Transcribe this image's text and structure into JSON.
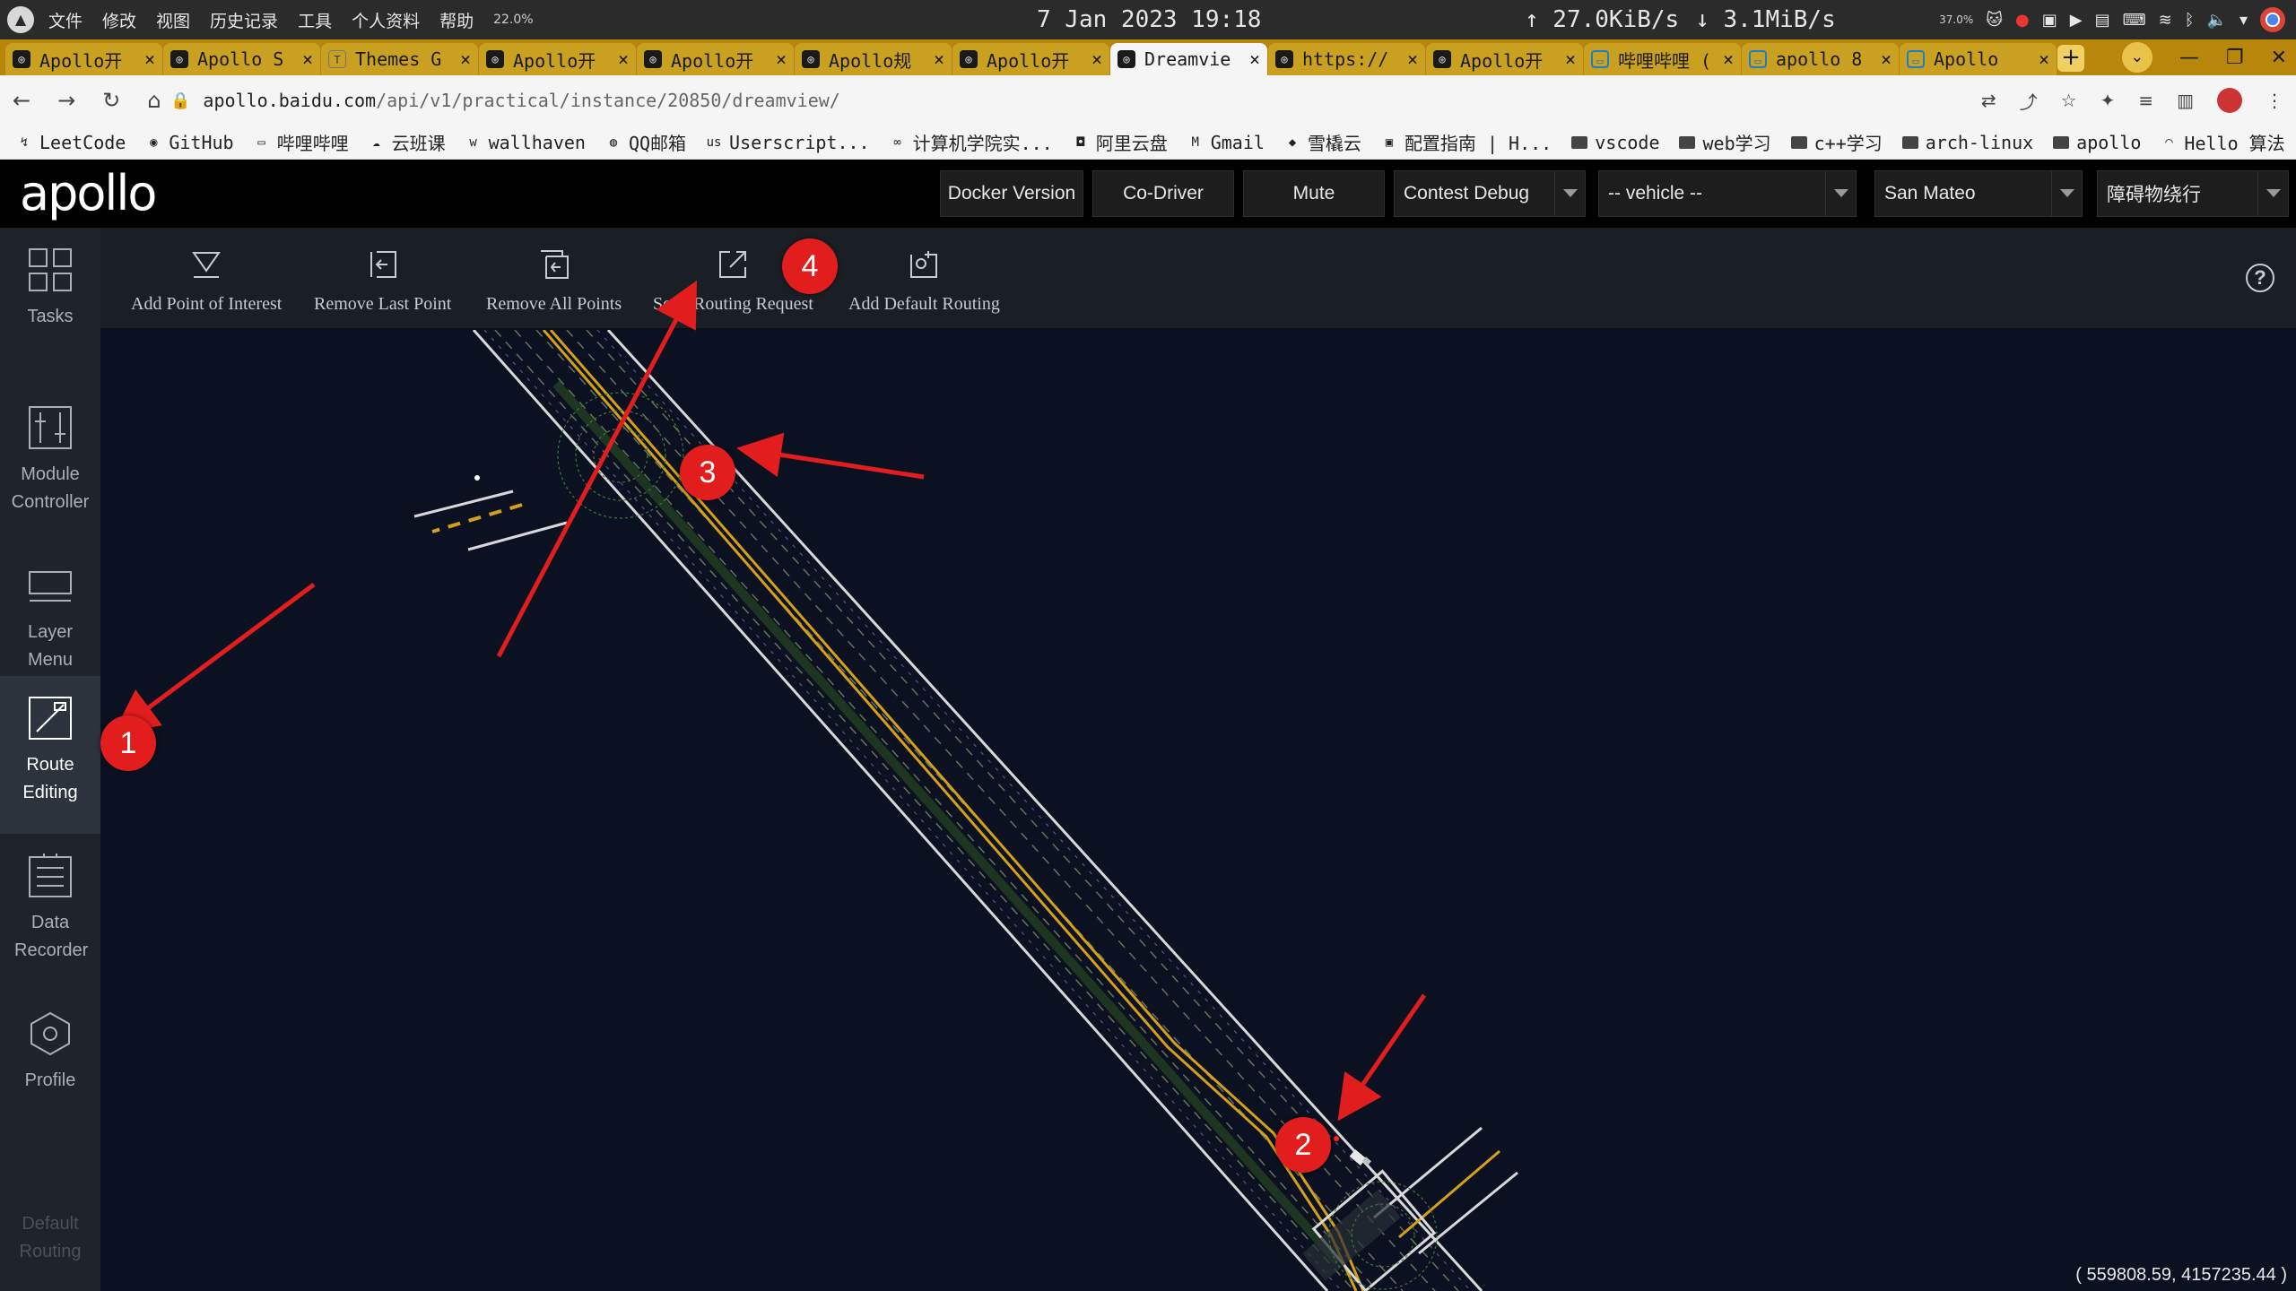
{
  "system_bar": {
    "menu": [
      "文件",
      "修改",
      "视图",
      "历史记录",
      "工具",
      "个人资料",
      "帮助"
    ],
    "cpu": "22.0%",
    "datetime": "7 Jan 2023 19:18",
    "net_up": "↑ 27.0KiB/s",
    "net_down": "↓ 3.1MiB/s",
    "tray_pct": "37.0%"
  },
  "tabs": [
    {
      "title": "Apollo开",
      "icon": "apollo"
    },
    {
      "title": "Apollo S",
      "icon": "apollo"
    },
    {
      "title": "Themes G",
      "icon": "themes"
    },
    {
      "title": "Apollo开",
      "icon": "apollo"
    },
    {
      "title": "Apollo开",
      "icon": "apollo"
    },
    {
      "title": "Apollo规",
      "icon": "apollo"
    },
    {
      "title": "Apollo开",
      "icon": "apollo"
    },
    {
      "title": "Dreamvie",
      "icon": "apollo",
      "active": true
    },
    {
      "title": "https://",
      "icon": "apollo"
    },
    {
      "title": "Apollo开",
      "icon": "apollo"
    },
    {
      "title": "哔哩哔哩 (",
      "icon": "bilibili"
    },
    {
      "title": "apollo 8",
      "icon": "bilibili"
    },
    {
      "title": "Apollo",
      "icon": "bilibili"
    }
  ],
  "url": {
    "host": "apollo.baidu.com",
    "path": "/api/v1/practical/instance/20850/dreamview/"
  },
  "bookmarks": [
    {
      "label": "LeetCode",
      "icon": "leetcode-icon"
    },
    {
      "label": "GitHub",
      "icon": "github-icon"
    },
    {
      "label": "哔哩哔哩",
      "icon": "bilibili-icon"
    },
    {
      "label": "云班课",
      "icon": "cloud-class-icon"
    },
    {
      "label": "wallhaven",
      "icon": "wallhaven-icon"
    },
    {
      "label": "QQ邮箱",
      "icon": "qqmail-icon"
    },
    {
      "label": "Userscript...",
      "icon": "userscript-icon"
    },
    {
      "label": "计算机学院实...",
      "icon": "college-icon"
    },
    {
      "label": "阿里云盘",
      "icon": "aliyun-icon"
    },
    {
      "label": "Gmail",
      "icon": "gmail-icon"
    },
    {
      "label": "雪橇云",
      "icon": "sled-icon"
    },
    {
      "label": "配置指南 | H...",
      "icon": "guide-icon"
    },
    {
      "label": "vscode",
      "icon": "folder-icon"
    },
    {
      "label": "web学习",
      "icon": "folder-icon"
    },
    {
      "label": "c++学习",
      "icon": "folder-icon"
    },
    {
      "label": "arch-linux",
      "icon": "folder-icon"
    },
    {
      "label": "apollo",
      "icon": "folder-icon"
    },
    {
      "label": "Hello 算法",
      "icon": "hello-icon"
    }
  ],
  "apollo": {
    "logo": "apollo",
    "buttons": {
      "docker": "Docker Version",
      "codriver": "Co-Driver",
      "mute": "Mute"
    },
    "selects": {
      "mode": "Contest Debug",
      "vehicle": "-- vehicle --",
      "map": "San Mateo",
      "scenario": "障碍物绕行"
    }
  },
  "sidebar": [
    {
      "label": "Tasks",
      "icon": "tasks-icon"
    },
    {
      "label": "Module Controller",
      "icon": "module-controller-icon"
    },
    {
      "label": "Layer Menu",
      "icon": "layer-menu-icon"
    },
    {
      "label": "Route Editing",
      "icon": "route-editing-icon",
      "active": true
    },
    {
      "label": "Data Recorder",
      "icon": "data-recorder-icon"
    },
    {
      "label": "Profile",
      "icon": "profile-icon"
    },
    {
      "label": "Default Routing",
      "icon": "",
      "disabled": true
    }
  ],
  "toolbar": {
    "add_poi": "Add Point of Interest",
    "remove_last": "Remove Last Point",
    "remove_all": "Remove All Points",
    "send_routing": "Send Routing Request",
    "add_default": "Add Default Routing",
    "help": "?"
  },
  "map": {
    "coords": "( 559808.59, 4157235.44 )"
  },
  "annotations": [
    "1",
    "2",
    "3",
    "4"
  ],
  "colors": {
    "annotation_red": "#e21d1d",
    "lane_yellow": "#d4a017",
    "road_edge": "#d8d8d8",
    "map_bg": "#0b1120",
    "tab_bar": "#b8860b"
  }
}
